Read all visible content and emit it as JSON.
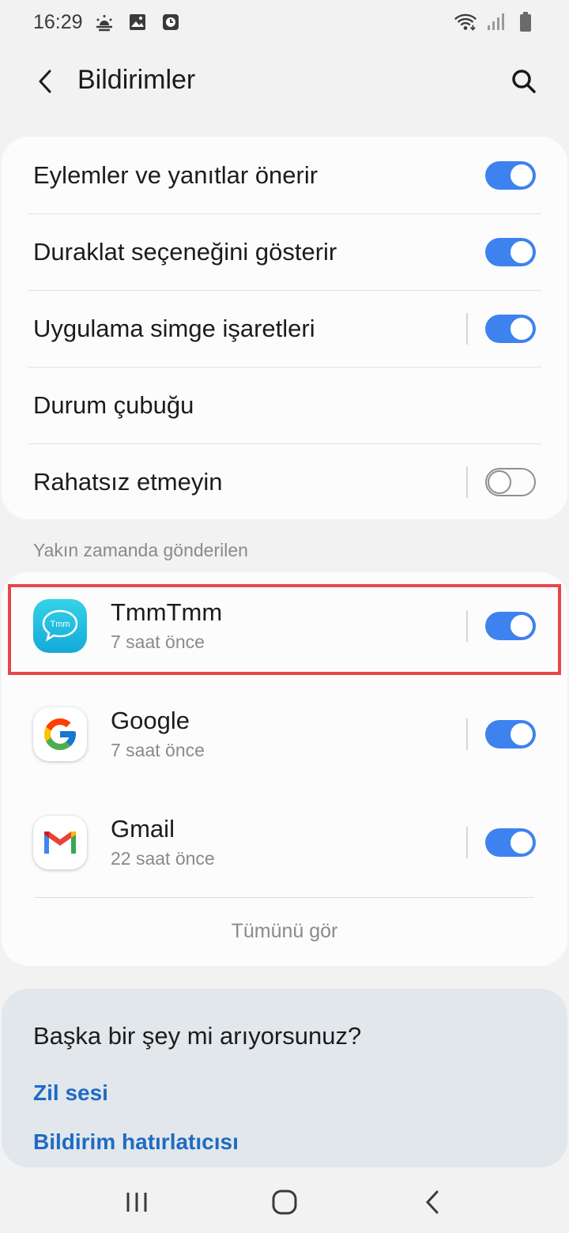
{
  "status_bar": {
    "time": "16:29",
    "left_icons": [
      "weather-icon",
      "gallery-icon",
      "clock-icon"
    ],
    "right_icons": [
      "wifi-icon",
      "signal-icon",
      "battery-icon"
    ]
  },
  "header": {
    "title": "Bildirimler",
    "back_icon": "back-arrow-icon",
    "search_icon": "search-icon"
  },
  "settings": [
    {
      "label": "Eylemler ve yanıtlar önerir",
      "toggle": "on",
      "divider": false
    },
    {
      "label": "Duraklat seçeneğini gösterir",
      "toggle": "on",
      "divider": false
    },
    {
      "label": "Uygulama simge işaretleri",
      "toggle": "on",
      "divider": true
    },
    {
      "label": "Durum çubuğu",
      "toggle": null,
      "divider": false
    },
    {
      "label": "Rahatsız etmeyin",
      "toggle": "off",
      "divider": true
    }
  ],
  "recent_section": {
    "label": "Yakın zamanda gönderilen",
    "apps": [
      {
        "name": "TmmTmm",
        "time": "7 saat önce",
        "icon": "tmmtmm-icon",
        "icon_text": "Tmm",
        "toggle": "on",
        "highlighted": true
      },
      {
        "name": "Google",
        "time": "7 saat önce",
        "icon": "google-icon",
        "toggle": "on",
        "highlighted": false
      },
      {
        "name": "Gmail",
        "time": "22 saat önce",
        "icon": "gmail-icon",
        "toggle": "on",
        "highlighted": false
      }
    ],
    "see_all": "Tümünü gör"
  },
  "looking_for": {
    "title": "Başka bir şey mi arıyorsunuz?",
    "links": [
      "Zil sesi",
      "Bildirim hatırlatıcısı"
    ]
  },
  "nav": {
    "recent_icon": "recent-apps-icon",
    "home_icon": "home-icon",
    "back_icon": "nav-back-icon"
  },
  "colors": {
    "accent": "#3e82ef",
    "link": "#1f6bc4",
    "highlight": "#e8464b"
  }
}
